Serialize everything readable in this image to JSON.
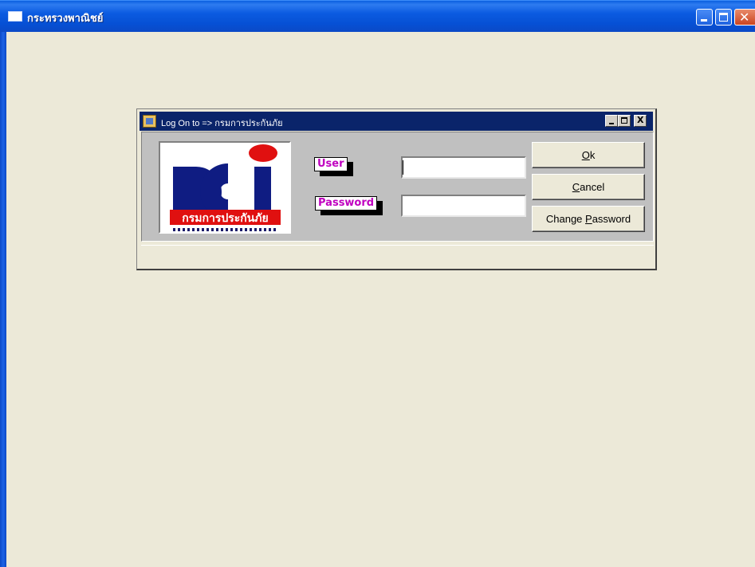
{
  "main_window": {
    "title": "กระทรวงพาณิชย์",
    "controls": {
      "minimize_icon": "minimize-icon",
      "maximize_icon": "maximize-icon",
      "close_icon": "close-icon"
    }
  },
  "dialog": {
    "title": "Log On to => กรมการประกันภัย",
    "controls": {
      "close_glyph": "X"
    },
    "logo": {
      "org_name": "กรมการประกันภัย",
      "brand_colors": {
        "navy": "#0F1C82",
        "red": "#E01010"
      }
    },
    "fields": {
      "user_label": "User",
      "user_value": "",
      "password_label": "Password",
      "password_value": ""
    },
    "buttons": {
      "ok": {
        "mnemonic": "O",
        "rest": "k"
      },
      "cancel": {
        "mnemonic": "C",
        "rest": "ancel"
      },
      "change_password": {
        "prefix": "Change ",
        "mnemonic": "P",
        "rest": "assword"
      }
    }
  },
  "colors": {
    "title_bar_blue": "#0B5BE1",
    "dialog_title_bar": "#0A246A",
    "label_text": "#C000C0",
    "workspace": "#ECE9D8"
  }
}
